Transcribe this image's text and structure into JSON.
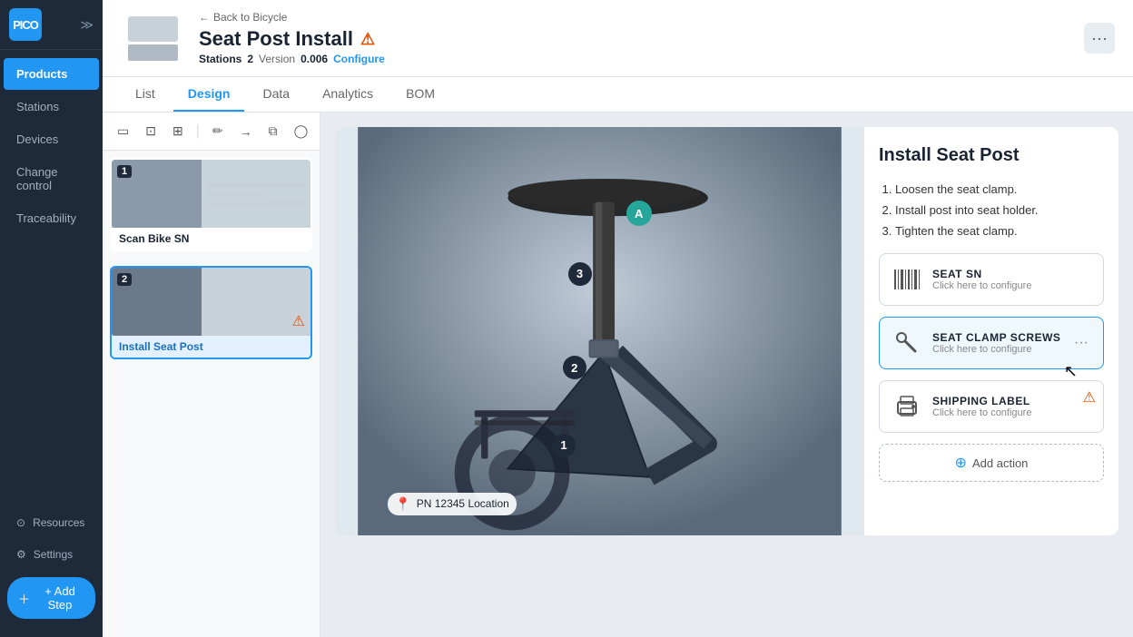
{
  "sidebar": {
    "logo_text": "PICO",
    "items": [
      {
        "id": "products",
        "label": "Products",
        "active": true
      },
      {
        "id": "stations",
        "label": "Stations",
        "active": false
      },
      {
        "id": "devices",
        "label": "Devices",
        "active": false
      },
      {
        "id": "change_control",
        "label": "Change control",
        "active": false
      },
      {
        "id": "traceability",
        "label": "Traceability",
        "active": false
      }
    ],
    "bottom_items": [
      {
        "id": "resources",
        "label": "Resources"
      },
      {
        "id": "settings",
        "label": "Settings"
      }
    ],
    "add_step_label": "+ Add Step"
  },
  "header": {
    "back_label": "Back to Bicycle",
    "title": "Seat Post Install",
    "warning": true,
    "stations_label": "Stations",
    "stations_value": "2",
    "version_label": "Version",
    "version_value": "0.006",
    "configure_label": "Configure"
  },
  "tabs": [
    {
      "id": "list",
      "label": "List"
    },
    {
      "id": "design",
      "label": "Design",
      "active": true
    },
    {
      "id": "data",
      "label": "Data"
    },
    {
      "id": "analytics",
      "label": "Analytics"
    },
    {
      "id": "bom",
      "label": "BOM"
    }
  ],
  "toolbar": {
    "tools": [
      "▭",
      "⊡",
      "⊞",
      "|",
      "✏",
      "→",
      "⧉",
      "◯",
      "⊙",
      "|",
      "☰",
      "🔗",
      "▲"
    ]
  },
  "steps": [
    {
      "id": "step1",
      "number": "1",
      "label": "Scan Bike SN",
      "active": false,
      "warning": false
    },
    {
      "id": "step2",
      "number": "2",
      "label": "Install Seat Post",
      "active": true,
      "warning": true
    }
  ],
  "canvas": {
    "step_title": "Install Seat Post",
    "instructions": [
      "Loosen the seat clamp.",
      "Install post into seat holder.",
      "Tighten the seat clamp."
    ],
    "location_label": "PN 12345 Location",
    "annotations": [
      {
        "label": "A",
        "type": "location"
      },
      {
        "label": "1",
        "type": "number"
      },
      {
        "label": "2",
        "type": "number"
      },
      {
        "label": "3",
        "type": "number"
      }
    ],
    "actions": [
      {
        "id": "seat_sn",
        "title": "SEAT SN",
        "subtitle": "Click here to configure",
        "icon": "barcode",
        "warning": false,
        "hovered": false
      },
      {
        "id": "seat_clamp_screws",
        "title": "SEAT CLAMP SCREWS",
        "subtitle": "Click here to configure",
        "icon": "wrench",
        "warning": false,
        "hovered": true
      },
      {
        "id": "shipping_label",
        "title": "SHIPPING LABEL",
        "subtitle": "Click here to configure",
        "icon": "printer",
        "warning": true,
        "hovered": false
      }
    ],
    "add_action_label": "Add action"
  }
}
